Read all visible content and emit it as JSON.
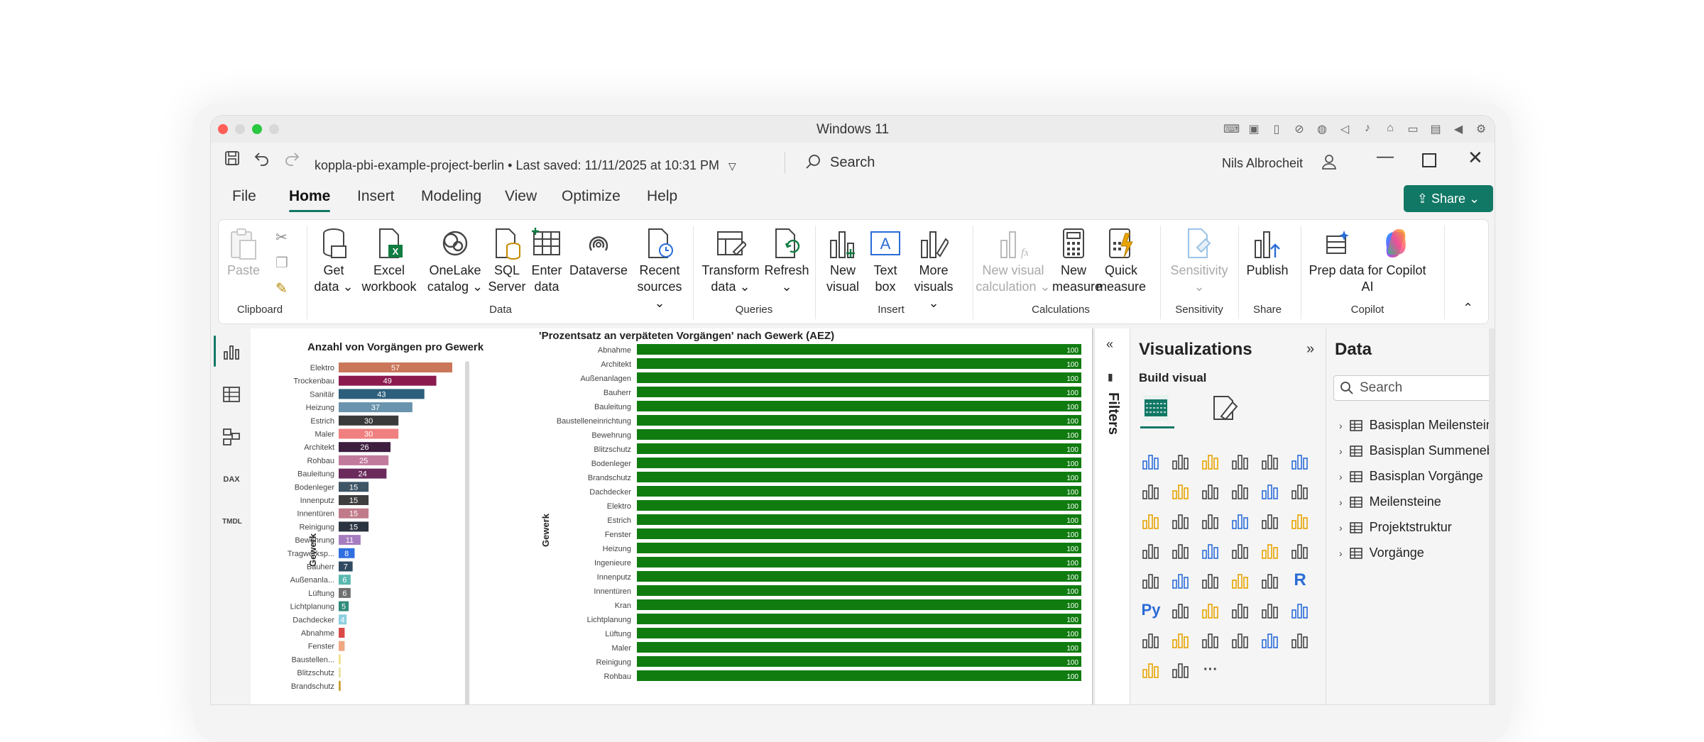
{
  "window": {
    "title": "Windows 11"
  },
  "app": {
    "filename": "koppla-pbi-example-project-berlin",
    "saved": "• Last saved: 11/11/2025 at 10:31 PM",
    "search_placeholder": "Search",
    "user": "Nils Albrocheit",
    "share_label": "Share"
  },
  "tabs": [
    "File",
    "Home",
    "Insert",
    "Modeling",
    "View",
    "Optimize",
    "Help"
  ],
  "ribbon": {
    "clipboard": {
      "paste": "Paste",
      "group": "Clipboard"
    },
    "data": {
      "group": "Data",
      "get_data": [
        "Get",
        "data"
      ],
      "excel": [
        "Excel",
        "workbook"
      ],
      "onelake": [
        "OneLake",
        "catalog"
      ],
      "sql": [
        "SQL",
        "Server"
      ],
      "enter": [
        "Enter",
        "data"
      ],
      "dataverse": "Dataverse",
      "recent": [
        "Recent",
        "sources"
      ]
    },
    "queries": {
      "group": "Queries",
      "transform": [
        "Transform",
        "data"
      ],
      "refresh": "Refresh"
    },
    "insert": {
      "group": "Insert",
      "new_visual": [
        "New",
        "visual"
      ],
      "text_box": [
        "Text",
        "box"
      ],
      "more": [
        "More",
        "visuals"
      ]
    },
    "calculations": {
      "group": "Calculations",
      "new_visual_calc": [
        "New visual",
        "calculation"
      ],
      "new_measure": [
        "New",
        "measure"
      ],
      "quick_measure": [
        "Quick",
        "measure"
      ]
    },
    "sensitivity": {
      "group": "Sensitivity",
      "label": "Sensitivity"
    },
    "share": {
      "group": "Share",
      "publish": "Publish"
    },
    "copilot": {
      "group": "Copilot",
      "prep": [
        "Prep data for Copilot",
        "AI"
      ]
    }
  },
  "chart_data": [
    {
      "type": "bar",
      "title": "Anzahl von Vorgängen pro Gewerk",
      "ylabel": "Gewerk",
      "categories": [
        "Elektro",
        "Trockenbau",
        "Sanitär",
        "Heizung",
        "Estrich",
        "Maler",
        "Architekt",
        "Rohbau",
        "Bauleitung",
        "Bodenleger",
        "Innenputz",
        "Innentüren",
        "Reinigung",
        "Bewehrung",
        "Tragwerksp...",
        "Bauherr",
        "Außenanla...",
        "Lüftung",
        "Lichtplanung",
        "Dachdecker",
        "Abnahme",
        "Fenster",
        "Baustellen...",
        "Blitzschutz",
        "Brandschutz"
      ],
      "values": [
        57,
        49,
        43,
        37,
        30,
        30,
        26,
        25,
        24,
        15,
        15,
        15,
        15,
        11,
        8,
        7,
        6,
        6,
        5,
        4,
        3,
        3,
        1,
        1,
        1
      ],
      "colors": [
        "#c9765a",
        "#8b1a4f",
        "#2d5f7c",
        "#6a93ad",
        "#3a3a3a",
        "#f08080",
        "#3d1e3f",
        "#c27a9c",
        "#6a2a5b",
        "#3e5566",
        "#3e3e3e",
        "#c07a8a",
        "#2a3440",
        "#a67cc0",
        "#2f6fe0",
        "#2f4a60",
        "#5ab8b0",
        "#707070",
        "#2f8a7a",
        "#8ccfe0",
        "#d84a4a",
        "#f0a882",
        "#f0e08a",
        "#e8e0a0",
        "#c8a030"
      ]
    },
    {
      "type": "bar",
      "title": "'Prozentsatz an verpäteten Vorgängen' nach Gewerk (AEZ)",
      "ylabel": "Gewerk",
      "categories": [
        "Abnahme",
        "Architekt",
        "Außenanlagen",
        "Bauherr",
        "Bauleitung",
        "Baustelleneinrichtung",
        "Bewehrung",
        "Blitzschutz",
        "Bodenleger",
        "Brandschutz",
        "Dachdecker",
        "Elektro",
        "Estrich",
        "Fenster",
        "Heizung",
        "Ingenieure",
        "Innenputz",
        "Innentüren",
        "Kran",
        "Lichtplanung",
        "Lüftung",
        "Maler",
        "Reinigung",
        "Rohbau"
      ],
      "values": [
        100,
        100,
        100,
        100,
        100,
        100,
        100,
        100,
        100,
        100,
        100,
        100,
        100,
        100,
        100,
        100,
        100,
        100,
        100,
        100,
        100,
        100,
        100,
        100
      ],
      "color": "#107c10"
    }
  ],
  "filters": {
    "label": "Filters"
  },
  "visualizations": {
    "title": "Visualizations",
    "build": "Build visual"
  },
  "data_pane": {
    "title": "Data",
    "search_placeholder": "Search",
    "tables": [
      "Basisplan Meilensteine",
      "Basisplan Summenebe...",
      "Basisplan Vorgänge",
      "Meilensteine",
      "Projektstruktur",
      "Vorgänge"
    ]
  }
}
